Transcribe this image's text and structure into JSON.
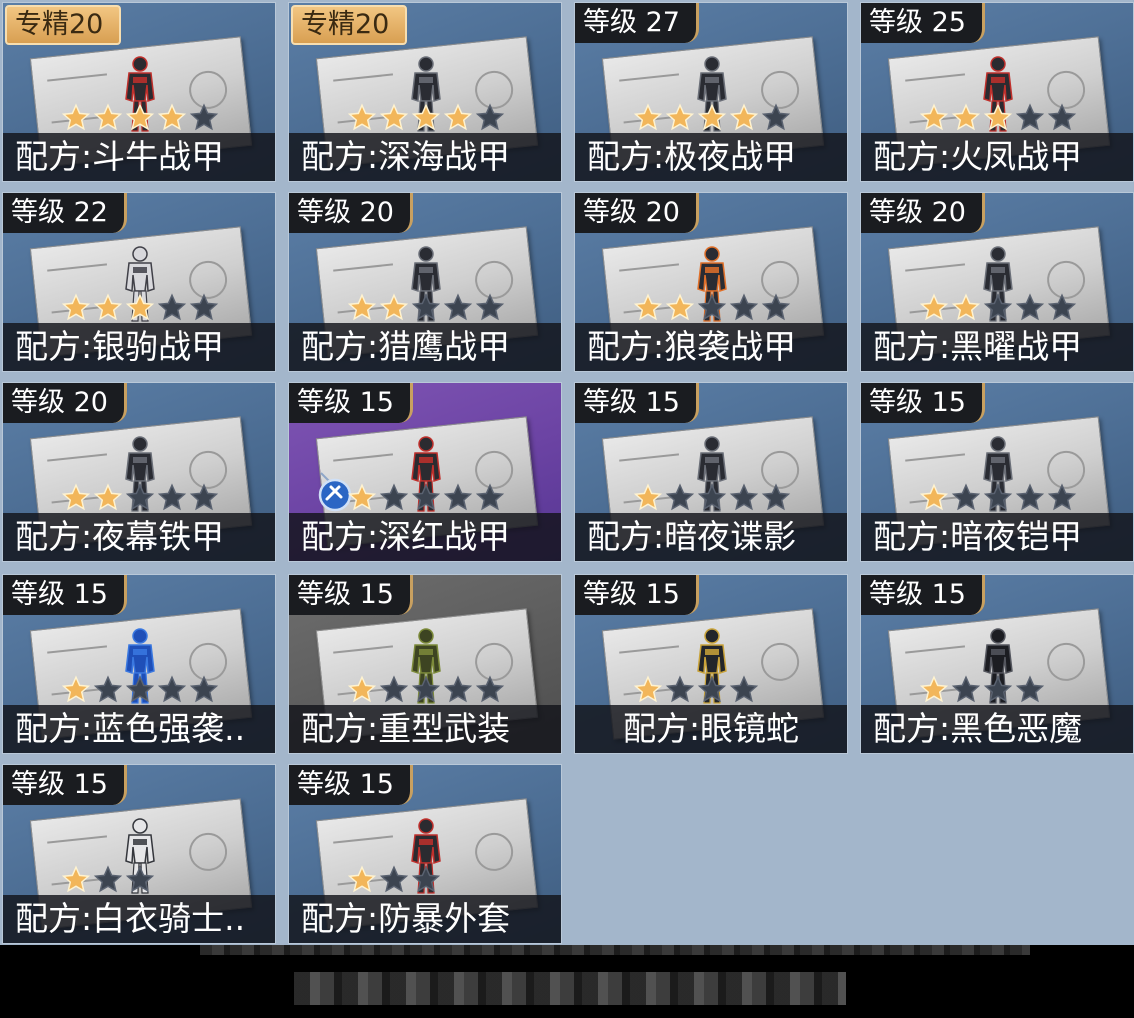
{
  "colors": {
    "background": "#a3b6cb",
    "card_blue": "#4f6f93",
    "card_purple": "#6b43a3",
    "card_gray": "#5c5c5c",
    "badge_dark": "#1a1c20",
    "badge_gold": "#e6b066",
    "star_filled": "#f2b65a",
    "star_empty": "#3c4450"
  },
  "cards": [
    {
      "badge": "专精20",
      "badge_style": "gold",
      "name": "配方:斗牛战甲",
      "stars": 4,
      "max_stars": 5,
      "bg": "blue",
      "icon": "red-black-armor-figure"
    },
    {
      "badge": "专精20",
      "badge_style": "gold",
      "name": "配方:深海战甲",
      "stars": 4,
      "max_stars": 5,
      "bg": "blue",
      "icon": "dark-armor-figure"
    },
    {
      "badge": "等级 27",
      "badge_style": "dark",
      "name": "配方:极夜战甲",
      "stars": 4,
      "max_stars": 5,
      "bg": "blue",
      "icon": "dark-armor-figure"
    },
    {
      "badge": "等级 25",
      "badge_style": "dark",
      "name": "配方:火凤战甲",
      "stars": 3,
      "max_stars": 5,
      "bg": "blue",
      "icon": "red-black-armor-figure"
    },
    {
      "badge": "等级 22",
      "badge_style": "dark",
      "name": "配方:银驹战甲",
      "stars": 3,
      "max_stars": 5,
      "bg": "blue",
      "icon": "silver-armor-figure"
    },
    {
      "badge": "等级 20",
      "badge_style": "dark",
      "name": "配方:猎鹰战甲",
      "stars": 2,
      "max_stars": 5,
      "bg": "blue",
      "icon": "dark-armor-figure"
    },
    {
      "badge": "等级 20",
      "badge_style": "dark",
      "name": "配方:狼袭战甲",
      "stars": 2,
      "max_stars": 5,
      "bg": "blue",
      "icon": "orange-armor-figure"
    },
    {
      "badge": "等级 20",
      "badge_style": "dark",
      "name": "配方:黑曜战甲",
      "stars": 2,
      "max_stars": 5,
      "bg": "blue",
      "icon": "dark-armor-figure"
    },
    {
      "badge": "等级 20",
      "badge_style": "dark",
      "name": "配方:夜幕铁甲",
      "stars": 2,
      "max_stars": 5,
      "bg": "blue",
      "icon": "dark-armor-figure"
    },
    {
      "badge": "等级 15",
      "badge_style": "dark",
      "name": "配方:深红战甲",
      "stars": 1,
      "max_stars": 5,
      "bg": "purple",
      "icon": "red-black-armor-figure",
      "extra_icon": "lure-tool-icon"
    },
    {
      "badge": "等级 15",
      "badge_style": "dark",
      "name": "配方:暗夜谍影",
      "stars": 1,
      "max_stars": 5,
      "bg": "blue",
      "icon": "dark-armor-figure"
    },
    {
      "badge": "等级 15",
      "badge_style": "dark",
      "name": "配方:暗夜铠甲",
      "stars": 1,
      "max_stars": 5,
      "bg": "blue",
      "icon": "dark-armor-figure"
    },
    {
      "badge": "等级 15",
      "badge_style": "dark",
      "name": "配方:蓝色强袭..",
      "stars": 1,
      "max_stars": 5,
      "bg": "blue",
      "icon": "blue-armor-figure"
    },
    {
      "badge": "等级 15",
      "badge_style": "dark",
      "name": "配方:重型武装",
      "stars": 1,
      "max_stars": 5,
      "bg": "gray",
      "icon": "olive-armor-figure"
    },
    {
      "badge": "等级 15",
      "badge_style": "dark",
      "name": "配方:眼镜蛇",
      "stars": 1,
      "max_stars": 4,
      "bg": "blue",
      "icon": "gold-black-armor-figure",
      "center": true
    },
    {
      "badge": "等级 15",
      "badge_style": "dark",
      "name": "配方:黑色恶魔",
      "stars": 1,
      "max_stars": 4,
      "bg": "blue",
      "icon": "hooded-black-figure"
    },
    {
      "badge": "等级 15",
      "badge_style": "dark",
      "name": "配方:白衣骑士..",
      "stars": 1,
      "max_stars": 3,
      "bg": "blue",
      "icon": "white-armor-figure"
    },
    {
      "badge": "等级 15",
      "badge_style": "dark",
      "name": "配方:防暴外套",
      "stars": 1,
      "max_stars": 3,
      "bg": "blue",
      "icon": "red-black-armor-figure"
    }
  ]
}
